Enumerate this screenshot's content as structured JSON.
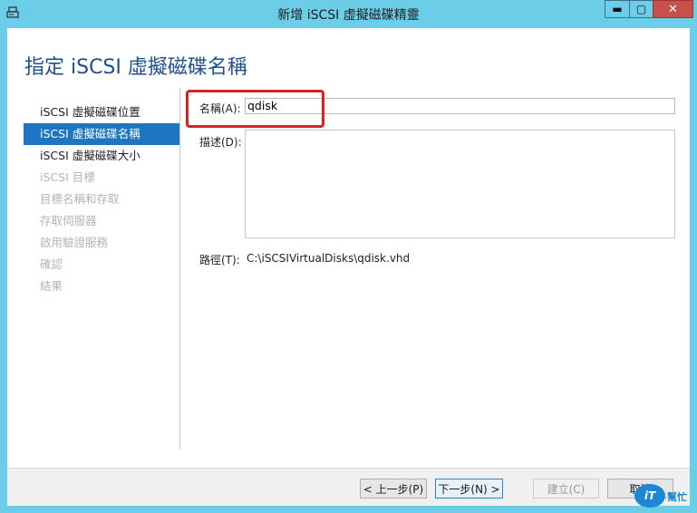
{
  "window": {
    "title": "新增 iSCSI 虛擬磁碟精靈",
    "controls": {
      "minimize": "▬",
      "maximize": "▢",
      "close": "✕"
    }
  },
  "page": {
    "heading": "指定 iSCSI 虛擬磁碟名稱"
  },
  "nav": {
    "items": [
      {
        "label": "iSCSI 虛擬磁碟位置",
        "state": "enabled"
      },
      {
        "label": "iSCSI 虛擬磁碟名稱",
        "state": "active"
      },
      {
        "label": "iSCSI 虛擬磁碟大小",
        "state": "enabled"
      },
      {
        "label": "iSCSI 目標",
        "state": "disabled"
      },
      {
        "label": "目標名稱和存取",
        "state": "disabled"
      },
      {
        "label": "存取伺服器",
        "state": "disabled"
      },
      {
        "label": "啟用驗證服務",
        "state": "disabled"
      },
      {
        "label": "確認",
        "state": "disabled"
      },
      {
        "label": "結果",
        "state": "disabled"
      }
    ]
  },
  "form": {
    "name_label": "名稱(A):",
    "name_value": "qdisk",
    "description_label": "描述(D):",
    "description_value": "",
    "path_label": "路徑(T):",
    "path_value": "C:\\iSCSIVirtualDisks\\qdisk.vhd"
  },
  "footer": {
    "back": "< 上一步(P)",
    "next": "下一步(N) >",
    "create": "建立(C)",
    "cancel": "取消"
  },
  "watermark": {
    "logo": "iT",
    "text": "幫忙"
  },
  "colors": {
    "accent": "#1e75c1",
    "frame": "#6ccde9",
    "highlight": "#d7231f"
  }
}
